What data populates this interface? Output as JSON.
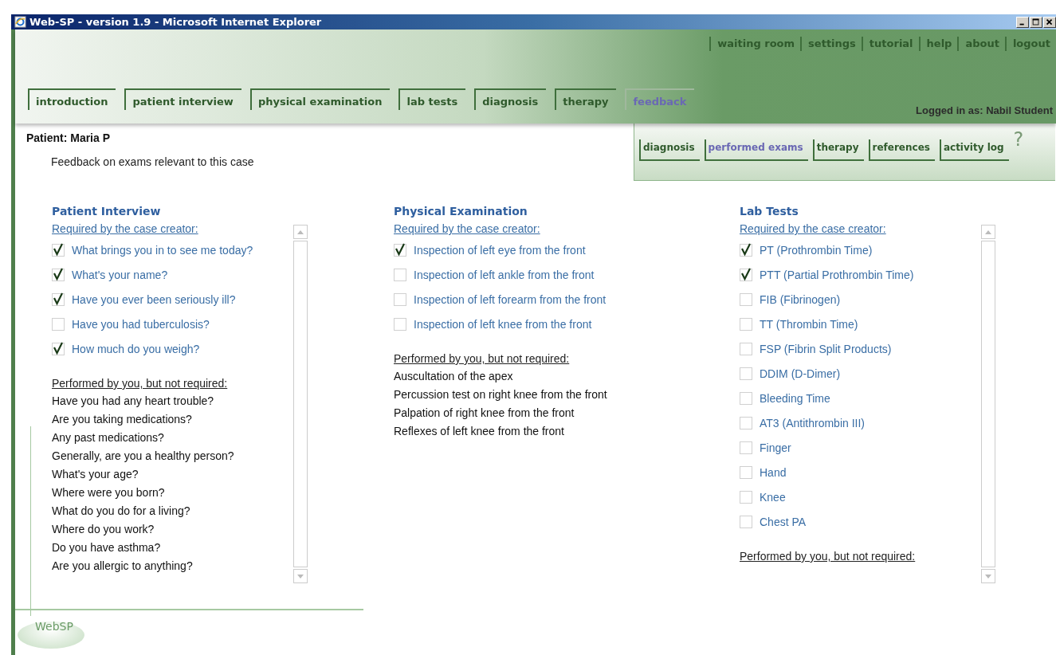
{
  "window": {
    "title": "Web-SP - version 1.9 - Microsoft Internet Explorer"
  },
  "top_links": [
    "waiting room",
    "settings",
    "tutorial",
    "help",
    "about",
    "logout"
  ],
  "nav_tabs": [
    {
      "label": "introduction",
      "selected": false
    },
    {
      "label": "patient interview",
      "selected": false
    },
    {
      "label": "physical examination",
      "selected": false
    },
    {
      "label": "lab tests",
      "selected": false
    },
    {
      "label": "diagnosis",
      "selected": false
    },
    {
      "label": "therapy",
      "selected": false
    },
    {
      "label": "feedback",
      "selected": true
    }
  ],
  "user": "Logged in as: Nabil Student",
  "patient": "Patient: Maria P",
  "subtitle": "Feedback on exams relevant to this case",
  "sub_tabs": [
    {
      "label": "diagnosis",
      "selected": false
    },
    {
      "label": "performed exams",
      "selected": true
    },
    {
      "label": "therapy",
      "selected": false
    },
    {
      "label": "references",
      "selected": false
    },
    {
      "label": "activity log",
      "selected": false
    }
  ],
  "help": "?",
  "sections": [
    {
      "title": "Patient Interview",
      "scrollable": true,
      "required_heading": "Required by the case creator:",
      "required": [
        {
          "label": "What brings you in to see me today?",
          "checked": true
        },
        {
          "label": "What's your name?",
          "checked": true
        },
        {
          "label": "Have you ever been seriously ill?",
          "checked": true
        },
        {
          "label": "Have you had tuberculosis?",
          "checked": false
        },
        {
          "label": "How much do you weigh?",
          "checked": true
        }
      ],
      "performed_heading": "Performed by you, but not required:",
      "performed": [
        "Have you had any heart trouble?",
        "Are you taking medications?",
        "Any past medications?",
        "Generally, are you a healthy person?",
        "What's your age?",
        "Where were you born?",
        "What do you do for a living?",
        "Where do you work?",
        "Do you have asthma?",
        "Are you allergic to anything?"
      ]
    },
    {
      "title": "Physical Examination",
      "scrollable": false,
      "required_heading": "Required by the case creator:",
      "required": [
        {
          "label": "Inspection of left eye from the front",
          "checked": true
        },
        {
          "label": "Inspection of left ankle from the front",
          "checked": false
        },
        {
          "label": "Inspection of left forearm from the front",
          "checked": false
        },
        {
          "label": "Inspection of left knee from the front",
          "checked": false
        }
      ],
      "performed_heading": "Performed by you, but not required:",
      "performed": [
        "Auscultation of the apex",
        "Percussion test on right knee from the front",
        "Palpation of right knee from the front",
        "Reflexes of left knee from the front"
      ]
    },
    {
      "title": "Lab Tests",
      "scrollable": true,
      "required_heading": "Required by the case creator:",
      "required": [
        {
          "label": "PT (Prothrombin Time)",
          "checked": true
        },
        {
          "label": "PTT (Partial Prothrombin Time)",
          "checked": true
        },
        {
          "label": "FIB (Fibrinogen)",
          "checked": false
        },
        {
          "label": "TT (Thrombin Time)",
          "checked": false
        },
        {
          "label": "FSP (Fibrin Split Products)",
          "checked": false
        },
        {
          "label": "DDIM (D-Dimer)",
          "checked": false
        },
        {
          "label": "Bleeding Time",
          "checked": false
        },
        {
          "label": "AT3 (Antithrombin III)",
          "checked": false
        },
        {
          "label": "Finger",
          "checked": false
        },
        {
          "label": "Hand",
          "checked": false
        },
        {
          "label": "Knee",
          "checked": false
        },
        {
          "label": "Chest PA",
          "checked": false
        }
      ],
      "performed_heading": "Performed by you, but not required:"
    }
  ],
  "logo": "WebSP"
}
